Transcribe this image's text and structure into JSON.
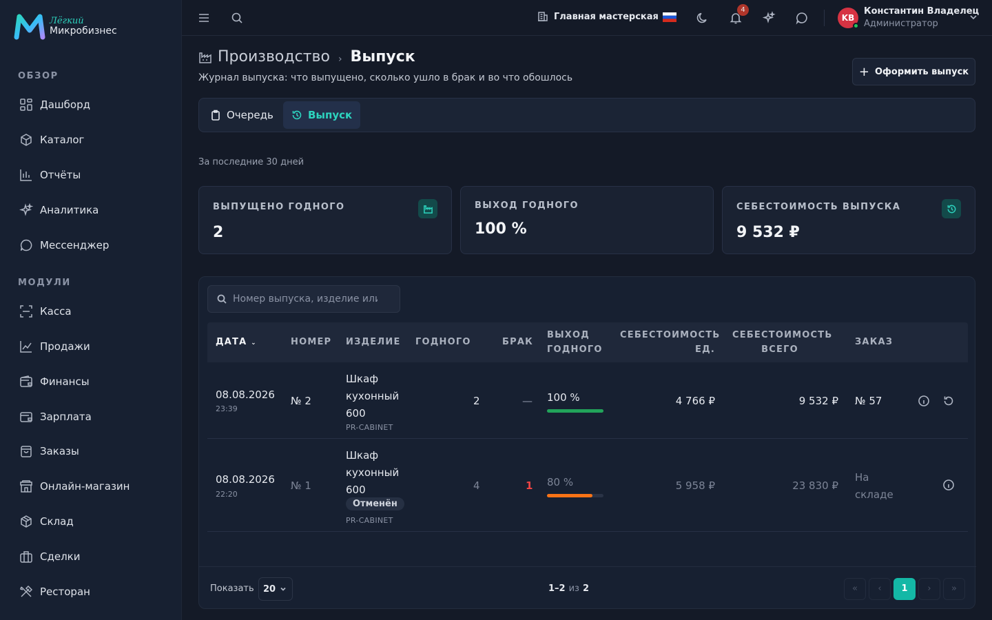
{
  "brand": {
    "line1": "Лёгкий",
    "line2": "Микробизнес"
  },
  "sidebar": {
    "sections": [
      {
        "title": "ОБЗОР",
        "items": [
          {
            "label": "Дашборд",
            "icon": "dashboard-icon"
          },
          {
            "label": "Каталог",
            "icon": "catalog-icon"
          },
          {
            "label": "Отчёты",
            "icon": "reports-icon"
          },
          {
            "label": "Аналитика",
            "icon": "analytics-icon"
          },
          {
            "label": "Мессенджер",
            "icon": "messenger-icon"
          }
        ]
      },
      {
        "title": "МОДУЛИ",
        "items": [
          {
            "label": "Касса",
            "icon": "cashier-icon"
          },
          {
            "label": "Продажи",
            "icon": "sales-icon"
          },
          {
            "label": "Финансы",
            "icon": "finance-icon"
          },
          {
            "label": "Зарплата",
            "icon": "salary-icon"
          },
          {
            "label": "Заказы",
            "icon": "orders-icon"
          },
          {
            "label": "Онлайн-магазин",
            "icon": "shop-icon"
          },
          {
            "label": "Склад",
            "icon": "warehouse-icon"
          },
          {
            "label": "Сделки",
            "icon": "deals-icon"
          },
          {
            "label": "Ресторан",
            "icon": "restaurant-icon"
          }
        ]
      }
    ]
  },
  "topbar": {
    "workspace": "Главная мастерская",
    "notifications_count": "4",
    "user": {
      "initials": "KB",
      "name": "Константин Владелец",
      "role": "Администратор"
    }
  },
  "page": {
    "breadcrumb_parent": "Производство",
    "breadcrumb_current": "Выпуск",
    "subtitle": "Журнал выпуска: что выпущено, сколько ушло в брак и во что обошлось",
    "primary_action": "Оформить выпуск",
    "tabs": [
      {
        "label": "Очередь",
        "active": false
      },
      {
        "label": "Выпуск",
        "active": true
      }
    ],
    "period": "За последние 30 дней"
  },
  "stats": [
    {
      "label": "ВЫПУЩЕНО ГОДНОГО",
      "value": "2",
      "icon": "factory-icon"
    },
    {
      "label": "ВЫХОД ГОДНОГО",
      "value": "100 %",
      "icon": ""
    },
    {
      "label": "СЕБЕСТОИМОСТЬ ВЫПУСКА",
      "value": "9 532 ₽",
      "icon": "history-icon"
    }
  ],
  "table": {
    "search_placeholder": "Номер выпуска, изделие или заказ",
    "columns": {
      "date": "ДАТА",
      "number": "НОМЕР",
      "product": "ИЗДЕЛИЕ",
      "good": "ГОДНОГО",
      "defect": "БРАК",
      "yield_l1": "ВЫХОД",
      "yield_l2": "ГОДНОГО",
      "unit_cost_l1": "СЕБЕСТОИМОСТЬ",
      "unit_cost_l2": "ЕД.",
      "total_cost_l1": "СЕБЕСТОИМОСТЬ",
      "total_cost_l2": "ВСЕГО",
      "order": "ЗАКАЗ"
    },
    "rows": [
      {
        "date": "08.08.2026",
        "time": "23:39",
        "number": "№ 2",
        "product_l1": "Шкаф",
        "product_l2": "кухонный",
        "product_l3": "600",
        "status": "",
        "sku": "PR-CABINET",
        "good": "2",
        "defect": "—",
        "yield": "100 %",
        "yield_value": 100,
        "yield_color": "#22a35a",
        "unit_cost": "4 766 ₽",
        "total_cost": "9 532 ₽",
        "order_l1": "№ 57",
        "order_l2": ""
      },
      {
        "date": "08.08.2026",
        "time": "22:20",
        "number": "№ 1",
        "product_l1": "Шкаф",
        "product_l2": "кухонный",
        "product_l3": "600",
        "status": "Отменён",
        "sku": "PR-CABINET",
        "good": "4",
        "defect": "1",
        "yield": "80 %",
        "yield_value": 80,
        "yield_color": "#f97316",
        "unit_cost": "5 958 ₽",
        "total_cost": "23 830 ₽",
        "order_l1": "На",
        "order_l2": "складе"
      }
    ]
  },
  "pagination": {
    "show_label": "Показать",
    "page_size": "20",
    "range": "1–2",
    "of": "из",
    "total": "2",
    "first": "«",
    "prev": "‹",
    "current": "1",
    "next": "›",
    "last": "»"
  },
  "colors": {
    "accent": "#14b8a6",
    "danger": "#ef4444",
    "background": "#141a27",
    "sidebar": "#172031"
  }
}
